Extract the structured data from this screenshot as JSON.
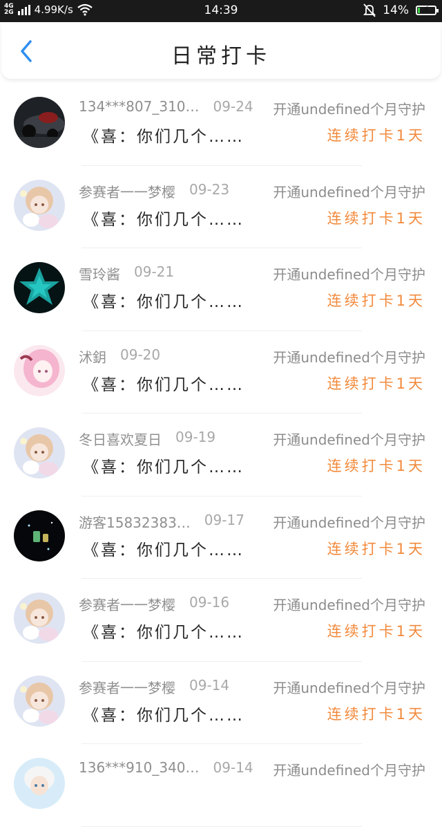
{
  "status_bar": {
    "network_top": "4G",
    "network_bottom": "2G",
    "speed": "4.99K/s",
    "time": "14:39",
    "battery_percent": "14%",
    "battery_level": 0.14,
    "icons": [
      "signal-icon",
      "wifi-icon",
      "bell-muted-icon",
      "battery-charging-icon"
    ]
  },
  "header": {
    "back_icon": "chevron-left-icon",
    "title": "日常打卡",
    "accent_color": "#2f8ff0"
  },
  "colors": {
    "streak": "#f28a3c",
    "name": "#8f8f8f",
    "message": "#2a2a2a"
  },
  "items": [
    {
      "name": "134***807_310…",
      "date": "09-24",
      "open_text": "开通undefined个月守护",
      "message": "《喜：你们几个……",
      "streak": "连续打卡1天",
      "avatar": "dark-car-avatar"
    },
    {
      "name": "参赛者一一梦樱",
      "date": "09-23",
      "open_text": "开通undefined个月守护",
      "message": "《喜：你们几个……",
      "streak": "连续打卡1天",
      "avatar": "anime-girl-avatar"
    },
    {
      "name": "雪玲酱",
      "date": "09-21",
      "open_text": "开通undefined个月守护",
      "message": "《喜：你们几个……",
      "streak": "连续打卡1天",
      "avatar": "teal-star-avatar"
    },
    {
      "name": "沭鈅",
      "date": "09-20",
      "open_text": "开通undefined个月守护",
      "message": "《喜：你们几个……",
      "streak": "连续打卡1天",
      "avatar": "pink-hair-girl-avatar"
    },
    {
      "name": "冬日喜欢夏日",
      "date": "09-19",
      "open_text": "开通undefined个月守护",
      "message": "《喜：你们几个……",
      "streak": "连续打卡1天",
      "avatar": "anime-girl-avatar"
    },
    {
      "name": "游客15832383…",
      "date": "09-17",
      "open_text": "开通undefined个月守护",
      "message": "《喜：你们几个……",
      "streak": "连续打卡1天",
      "avatar": "glowing-jars-avatar"
    },
    {
      "name": "参赛者一一梦樱",
      "date": "09-16",
      "open_text": "开通undefined个月守护",
      "message": "《喜：你们几个……",
      "streak": "连续打卡1天",
      "avatar": "anime-girl-avatar"
    },
    {
      "name": "参赛者一一梦樱",
      "date": "09-14",
      "open_text": "开通undefined个月守护",
      "message": "《喜：你们几个……",
      "streak": "连续打卡1天",
      "avatar": "anime-girl-avatar"
    },
    {
      "name": "136***910_340…",
      "date": "09-14",
      "open_text": "开通undefined个月守护",
      "message": "",
      "streak": "",
      "avatar": "white-hair-boy-avatar"
    }
  ]
}
